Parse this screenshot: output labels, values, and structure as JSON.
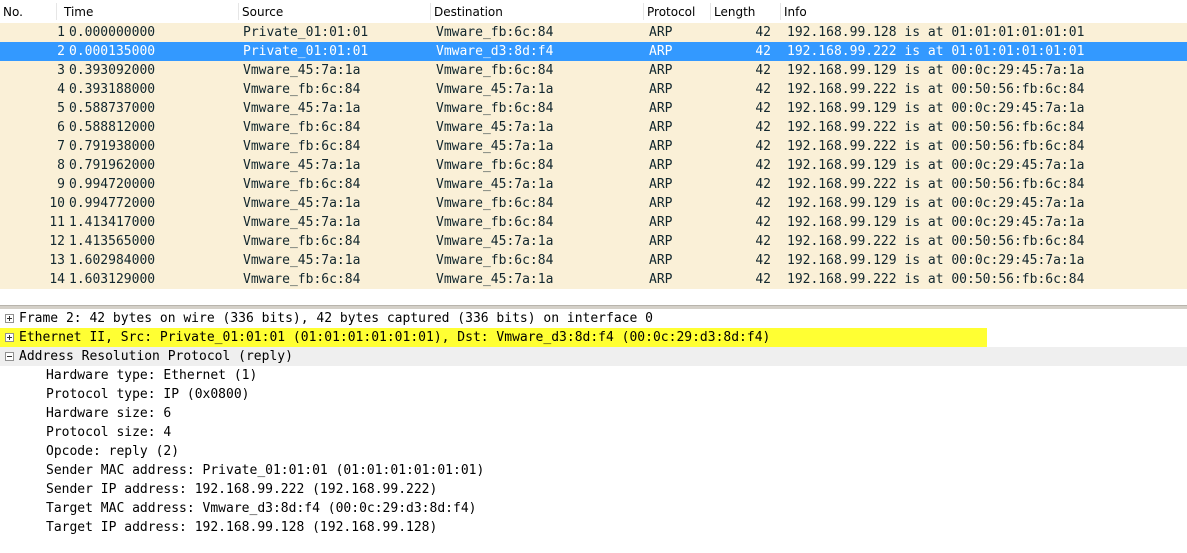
{
  "packet_list": {
    "columns": {
      "no": "No.",
      "time": "Time",
      "source": "Source",
      "destination": "Destination",
      "protocol": "Protocol",
      "length": "Length",
      "info": "Info"
    },
    "selected_index": 1,
    "rows": [
      {
        "no": "1",
        "time": "0.000000000",
        "src": "Private_01:01:01",
        "dst": "Vmware_fb:6c:84",
        "proto": "ARP",
        "len": "42",
        "info": "192.168.99.128 is at 01:01:01:01:01:01"
      },
      {
        "no": "2",
        "time": "0.000135000",
        "src": "Private_01:01:01",
        "dst": "Vmware_d3:8d:f4",
        "proto": "ARP",
        "len": "42",
        "info": "192.168.99.222 is at 01:01:01:01:01:01"
      },
      {
        "no": "3",
        "time": "0.393092000",
        "src": "Vmware_45:7a:1a",
        "dst": "Vmware_fb:6c:84",
        "proto": "ARP",
        "len": "42",
        "info": "192.168.99.129 is at 00:0c:29:45:7a:1a"
      },
      {
        "no": "4",
        "time": "0.393188000",
        "src": "Vmware_fb:6c:84",
        "dst": "Vmware_45:7a:1a",
        "proto": "ARP",
        "len": "42",
        "info": "192.168.99.222 is at 00:50:56:fb:6c:84"
      },
      {
        "no": "5",
        "time": "0.588737000",
        "src": "Vmware_45:7a:1a",
        "dst": "Vmware_fb:6c:84",
        "proto": "ARP",
        "len": "42",
        "info": "192.168.99.129 is at 00:0c:29:45:7a:1a"
      },
      {
        "no": "6",
        "time": "0.588812000",
        "src": "Vmware_fb:6c:84",
        "dst": "Vmware_45:7a:1a",
        "proto": "ARP",
        "len": "42",
        "info": "192.168.99.222 is at 00:50:56:fb:6c:84"
      },
      {
        "no": "7",
        "time": "0.791938000",
        "src": "Vmware_fb:6c:84",
        "dst": "Vmware_45:7a:1a",
        "proto": "ARP",
        "len": "42",
        "info": "192.168.99.222 is at 00:50:56:fb:6c:84"
      },
      {
        "no": "8",
        "time": "0.791962000",
        "src": "Vmware_45:7a:1a",
        "dst": "Vmware_fb:6c:84",
        "proto": "ARP",
        "len": "42",
        "info": "192.168.99.129 is at 00:0c:29:45:7a:1a"
      },
      {
        "no": "9",
        "time": "0.994720000",
        "src": "Vmware_fb:6c:84",
        "dst": "Vmware_45:7a:1a",
        "proto": "ARP",
        "len": "42",
        "info": "192.168.99.222 is at 00:50:56:fb:6c:84"
      },
      {
        "no": "10",
        "time": "0.994772000",
        "src": "Vmware_45:7a:1a",
        "dst": "Vmware_fb:6c:84",
        "proto": "ARP",
        "len": "42",
        "info": "192.168.99.129 is at 00:0c:29:45:7a:1a"
      },
      {
        "no": "11",
        "time": "1.413417000",
        "src": "Vmware_45:7a:1a",
        "dst": "Vmware_fb:6c:84",
        "proto": "ARP",
        "len": "42",
        "info": "192.168.99.129 is at 00:0c:29:45:7a:1a"
      },
      {
        "no": "12",
        "time": "1.413565000",
        "src": "Vmware_fb:6c:84",
        "dst": "Vmware_45:7a:1a",
        "proto": "ARP",
        "len": "42",
        "info": "192.168.99.222 is at 00:50:56:fb:6c:84"
      },
      {
        "no": "13",
        "time": "1.602984000",
        "src": "Vmware_45:7a:1a",
        "dst": "Vmware_fb:6c:84",
        "proto": "ARP",
        "len": "42",
        "info": "192.168.99.129 is at 00:0c:29:45:7a:1a"
      },
      {
        "no": "14",
        "time": "1.603129000",
        "src": "Vmware_fb:6c:84",
        "dst": "Vmware_45:7a:1a",
        "proto": "ARP",
        "len": "42",
        "info": "192.168.99.222 is at 00:50:56:fb:6c:84"
      }
    ]
  },
  "details": {
    "frame": "Frame 2: 42 bytes on wire (336 bits), 42 bytes captured (336 bits) on interface 0",
    "ethernet": "Ethernet II, Src: Private_01:01:01 (01:01:01:01:01:01), Dst: Vmware_d3:8d:f4 (00:0c:29:d3:8d:f4)",
    "arp": "Address Resolution Protocol (reply)",
    "arp_fields": [
      "Hardware type: Ethernet (1)",
      "Protocol type: IP (0x0800)",
      "Hardware size: 6",
      "Protocol size: 4",
      "Opcode: reply (2)",
      "Sender MAC address: Private_01:01:01 (01:01:01:01:01:01)",
      "Sender IP address: 192.168.99.222 (192.168.99.222)",
      "Target MAC address: Vmware_d3:8d:f4 (00:0c:29:d3:8d:f4)",
      "Target IP address: 192.168.99.128 (192.168.99.128)"
    ]
  },
  "colors": {
    "row_bg": "#faf0d7",
    "row_text": "#12272e",
    "selected_bg": "#3399ff",
    "highlight_yellow": "#ffff33"
  }
}
